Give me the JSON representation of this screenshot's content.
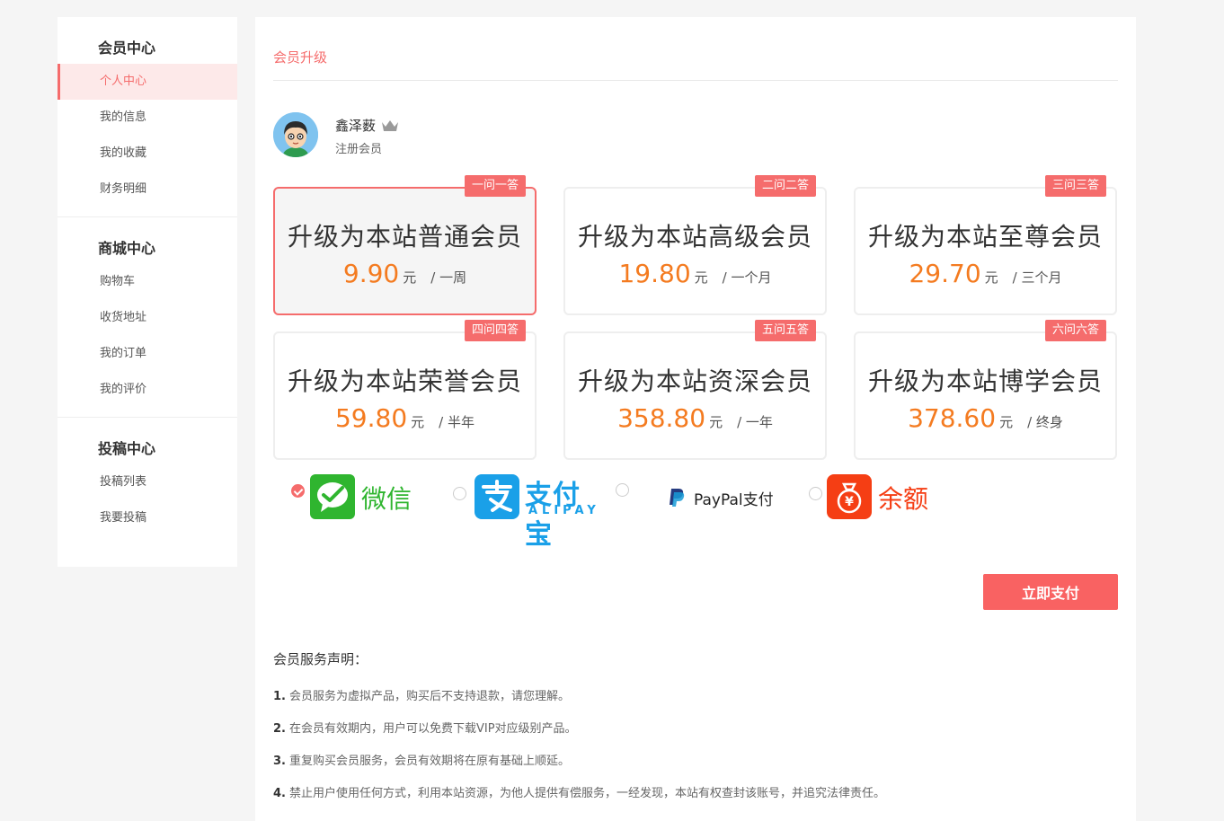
{
  "sidebar": {
    "groups": [
      {
        "title": "会员中心",
        "items": [
          {
            "label": "个人中心"
          },
          {
            "label": "我的信息"
          },
          {
            "label": "我的收藏"
          },
          {
            "label": "财务明细"
          }
        ]
      },
      {
        "title": "商城中心",
        "items": [
          {
            "label": "购物车"
          },
          {
            "label": "收货地址"
          },
          {
            "label": "我的订单"
          },
          {
            "label": "我的评价"
          }
        ]
      },
      {
        "title": "投稿中心",
        "items": [
          {
            "label": "投稿列表"
          },
          {
            "label": "我要投稿"
          }
        ]
      }
    ]
  },
  "main": {
    "header": "会员升级",
    "user": {
      "name": "鑫泽薮",
      "role": "注册会员"
    },
    "plans": [
      {
        "tag": "一问一答",
        "title": "升级为本站普通会员",
        "price": "9.90",
        "unit": "元",
        "period": "/ 一周",
        "selected": true
      },
      {
        "tag": "二问二答",
        "title": "升级为本站高级会员",
        "price": "19.80",
        "unit": "元",
        "period": "/ 一个月"
      },
      {
        "tag": "三问三答",
        "title": "升级为本站至尊会员",
        "price": "29.70",
        "unit": "元",
        "period": "/ 三个月"
      },
      {
        "tag": "四问四答",
        "title": "升级为本站荣誉会员",
        "price": "59.80",
        "unit": "元",
        "period": "/ 半年"
      },
      {
        "tag": "五问五答",
        "title": "升级为本站资深会员",
        "price": "358.80",
        "unit": "元",
        "period": "/ 一年"
      },
      {
        "tag": "六问六答",
        "title": "升级为本站博学会员",
        "price": "378.60",
        "unit": "元",
        "period": "/ 终身"
      }
    ],
    "payment": {
      "wechat": "微信",
      "alipay_cn": "支付宝",
      "alipay_en": "ALIPAY",
      "paypal": "PayPal支付",
      "balance": "余额",
      "selected": "wechat"
    },
    "pay_button": "立即支付",
    "notice": {
      "title": "会员服务声明：",
      "items": [
        {
          "num": "1.",
          "text": "会员服务为虚拟产品，购买后不支持退款，请您理解。"
        },
        {
          "num": "2.",
          "text": "在会员有效期内，用户可以免费下载VIP对应级别产品。"
        },
        {
          "num": "3.",
          "text": "重复购买会员服务，会员有效期将在原有基础上顺延。"
        },
        {
          "num": "4.",
          "text": "禁止用户使用任何方式，利用本站资源，为他人提供有偿服务，一经发现，本站有权查封该账号，并追究法律责任。"
        }
      ]
    }
  },
  "colors": {
    "accent": "#f56c6c",
    "price": "#f47b20",
    "wechat": "#2fb52f",
    "alipay": "#1aa0e8",
    "balance": "#f53e14"
  }
}
